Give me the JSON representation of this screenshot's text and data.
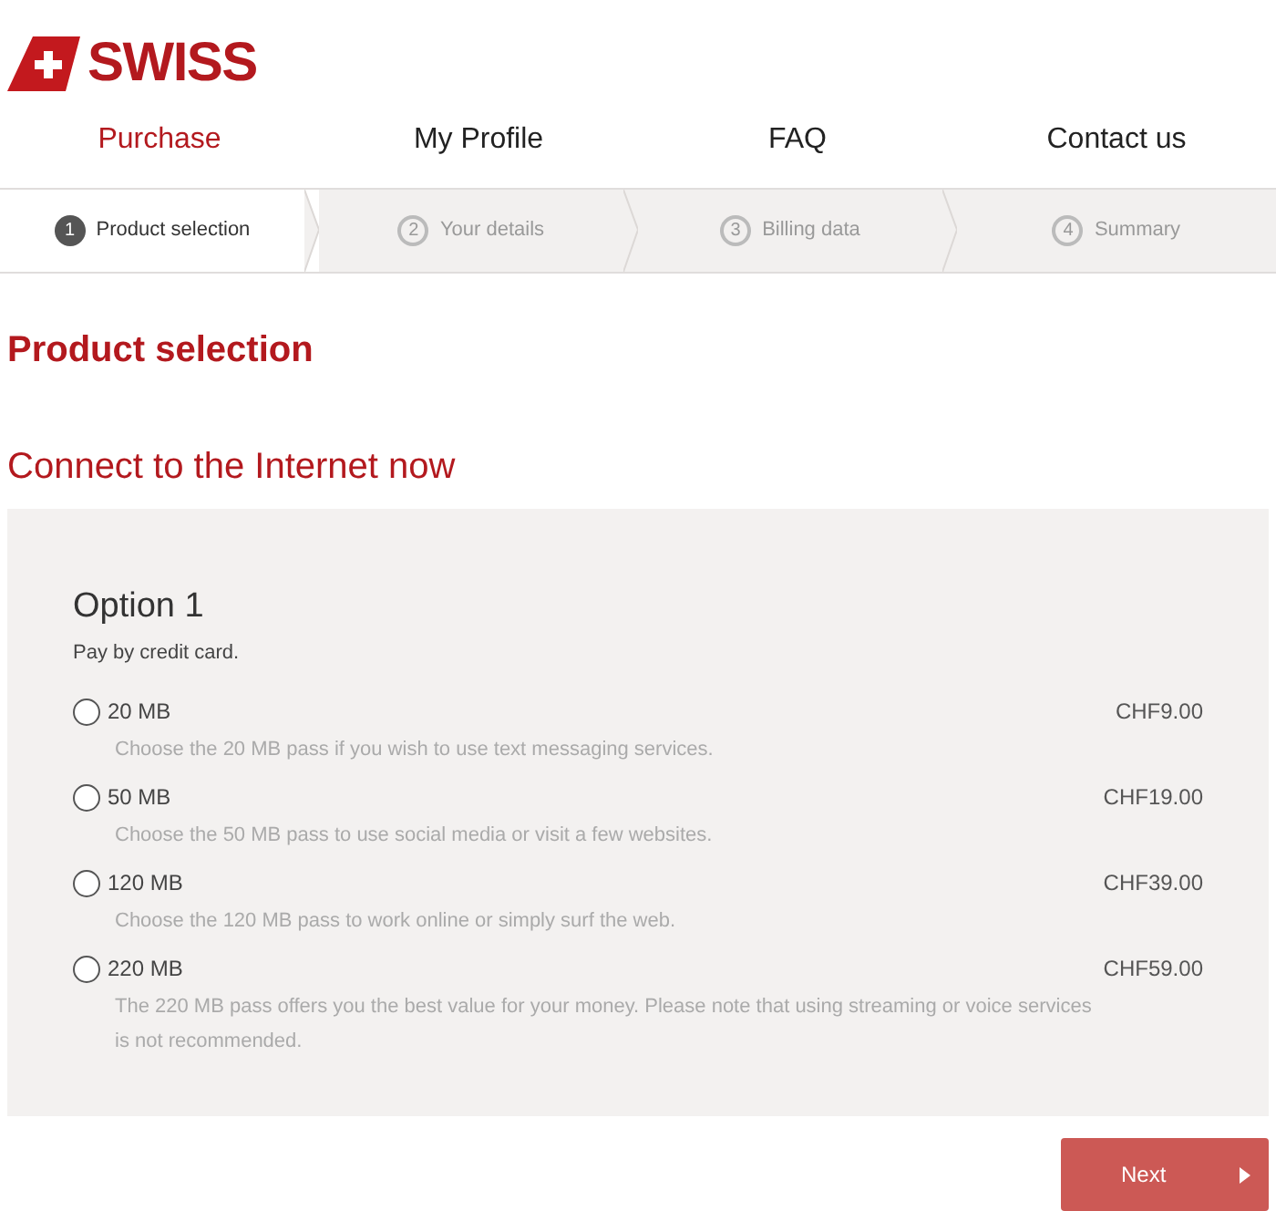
{
  "logo": {
    "text": "SWISS"
  },
  "nav": [
    {
      "label": "Purchase",
      "selected": true
    },
    {
      "label": "My Profile",
      "selected": false
    },
    {
      "label": "FAQ",
      "selected": false
    },
    {
      "label": "Contact us",
      "selected": false
    }
  ],
  "steps": [
    {
      "number": "1",
      "label": "Product selection",
      "selected": true
    },
    {
      "number": "2",
      "label": "Your details",
      "selected": false
    },
    {
      "number": "3",
      "label": "Billing data",
      "selected": false
    },
    {
      "number": "4",
      "label": "Summary",
      "selected": false
    }
  ],
  "heading": "Product selection",
  "subheading": "Connect to the Internet now",
  "option": {
    "title": "Option 1",
    "subtitle": "Pay by credit card.",
    "passes": [
      {
        "name": "20 MB",
        "price": "CHF9.00",
        "description": "Choose the 20 MB pass if you wish to use text messaging services.",
        "selected": false
      },
      {
        "name": "50 MB",
        "price": "CHF19.00",
        "description": "Choose the 50 MB pass to use social media or visit a few websites.",
        "selected": false
      },
      {
        "name": "120 MB",
        "price": "CHF39.00",
        "description": "Choose the 120 MB pass to work online or simply surf the web.",
        "selected": false
      },
      {
        "name": "220 MB",
        "price": "CHF59.00",
        "description": "The 220 MB pass offers you the best value for your money. Please note that using streaming or voice services is not recommended.",
        "selected": false
      }
    ]
  },
  "next_button": {
    "label": "Next"
  }
}
